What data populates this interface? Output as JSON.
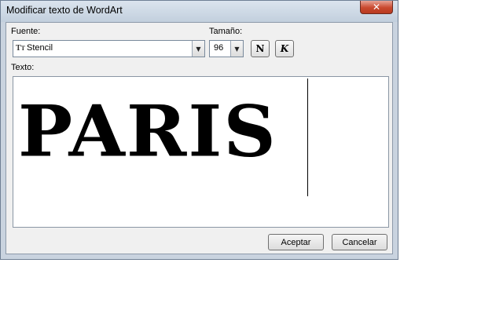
{
  "window": {
    "title": "Modificar texto de WordArt",
    "close_glyph": "✕"
  },
  "font": {
    "label": "Fuente:",
    "value": "Stencil",
    "icon": "truetype-font-icon"
  },
  "size": {
    "label": "Tamaño:",
    "value": "96"
  },
  "format": {
    "bold_glyph": "N",
    "italic_glyph": "K"
  },
  "text": {
    "label": "Texto:",
    "value": "PARIS"
  },
  "buttons": {
    "ok": "Aceptar",
    "cancel": "Cancelar"
  },
  "dropdown_arrow": "▼"
}
